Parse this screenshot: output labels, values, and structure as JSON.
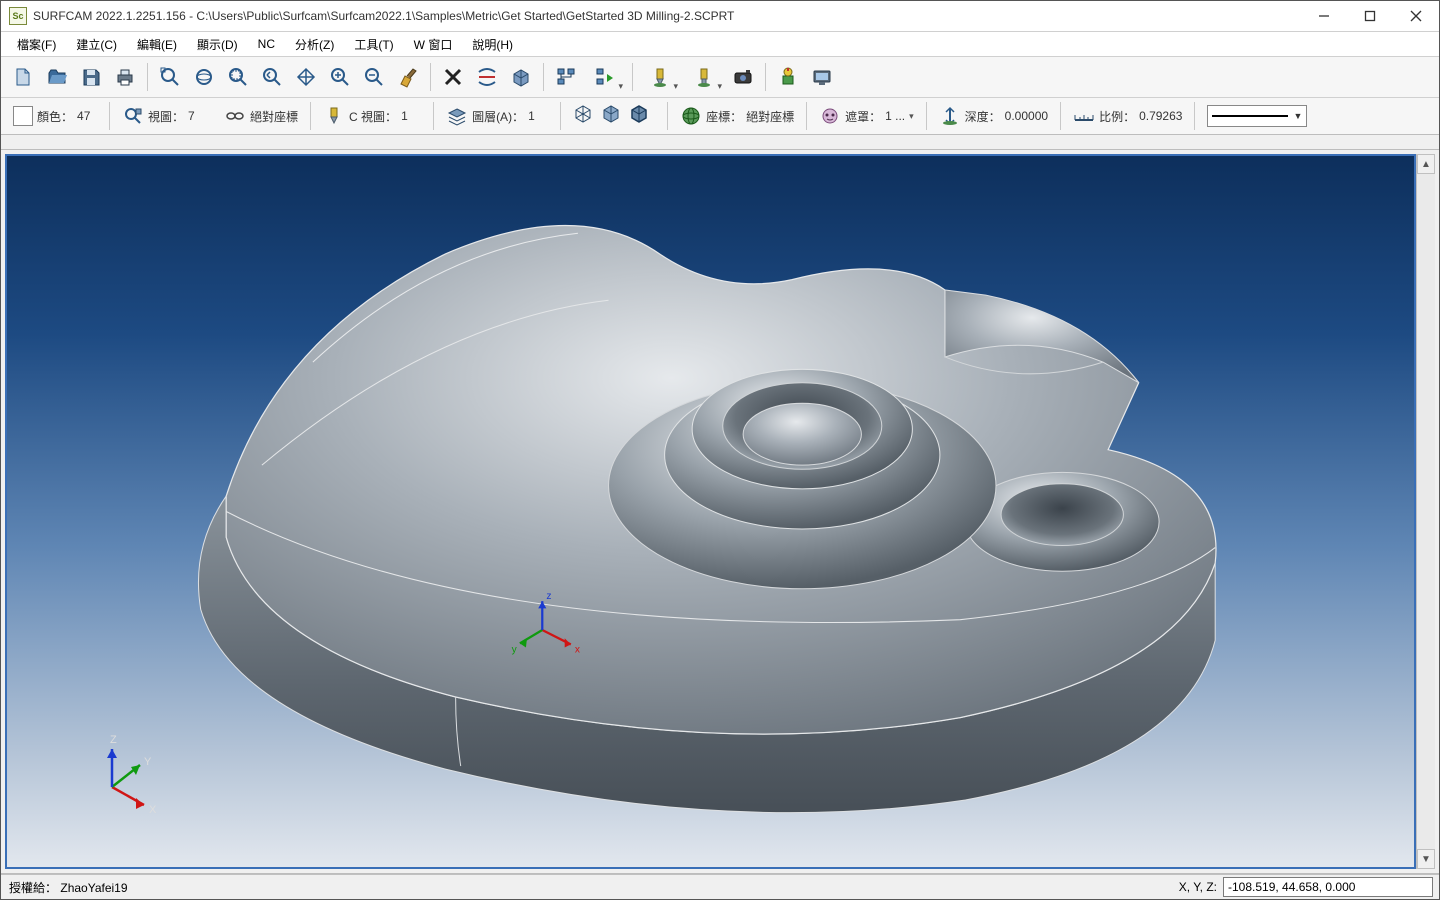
{
  "titlebar": {
    "app_icon_text": "Sc",
    "title": "SURFCAM 2022.1.2251.156 - C:\\Users\\Public\\Surfcam\\Surfcam2022.1\\Samples\\Metric\\Get Started\\GetStarted 3D Milling-2.SCPRT"
  },
  "menus": [
    "檔案(F)",
    "建立(C)",
    "編輯(E)",
    "顯示(D)",
    "NC",
    "分析(Z)",
    "工具(T)",
    "W 窗口",
    "說明(H)"
  ],
  "status_row": {
    "color_label": "顏色：",
    "color_value": "47",
    "view_label": "視圖：",
    "view_value": "7",
    "coord_icon_label": "絕對座標",
    "cview_label": "C 視圖：",
    "cview_value": "1",
    "layer_label": "圖層(A)：",
    "layer_value": "1",
    "coord_label": "座標：",
    "coord_value": "絕對座標",
    "mask_label": "遮罩：",
    "mask_value": "1 ...",
    "depth_label": "深度：",
    "depth_value": "0.00000",
    "scale_label": "比例：",
    "scale_value": "0.79263"
  },
  "axis_labels": {
    "x": "X",
    "y": "Y",
    "z": "Z"
  },
  "origin_labels": {
    "x": "x",
    "y": "y",
    "z": "z"
  },
  "statusbar": {
    "license_label": "授權給：",
    "license_value": "ZhaoYafei19",
    "xyz_label": "X, Y, Z:",
    "xyz_value": "-108.519, 44.658, 0.000"
  },
  "mask_dd": "▾"
}
